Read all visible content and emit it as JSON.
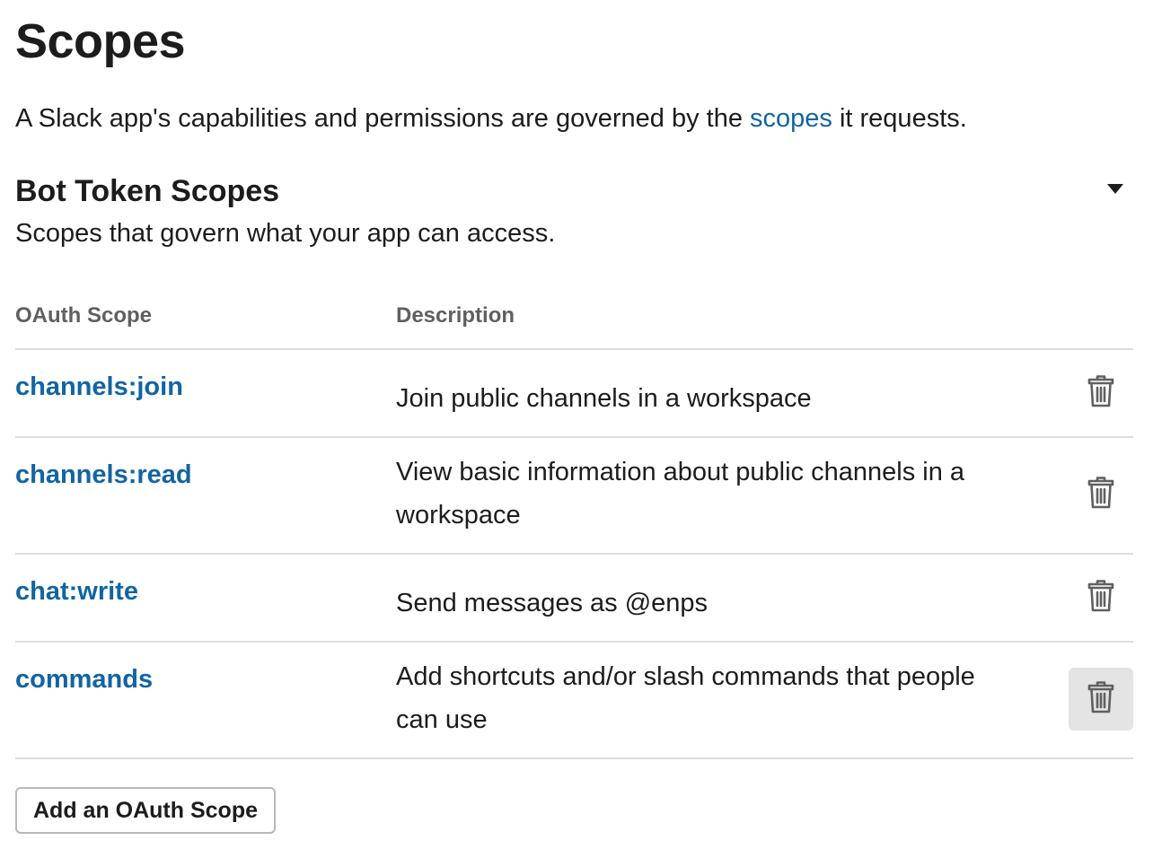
{
  "page": {
    "title": "Scopes",
    "intro_before": "A Slack app's capabilities and permissions are governed by the ",
    "intro_link": "scopes",
    "intro_after": " it requests."
  },
  "section": {
    "title": "Bot Token Scopes",
    "subtitle": "Scopes that govern what your app can access.",
    "collapse_icon": "caret-down-icon"
  },
  "table": {
    "headers": {
      "scope": "OAuth Scope",
      "description": "Description"
    },
    "rows": [
      {
        "scope": "channels:join",
        "description": "Join public channels in a workspace",
        "delete_icon": "trash-icon"
      },
      {
        "scope": "channels:read",
        "description": "View basic information about public channels in a workspace",
        "delete_icon": "trash-icon"
      },
      {
        "scope": "chat:write",
        "description": "Send messages as @enps",
        "delete_icon": "trash-icon"
      },
      {
        "scope": "commands",
        "description": "Add shortcuts and/or slash commands that people can use",
        "delete_icon": "trash-icon",
        "hovered": true
      }
    ]
  },
  "actions": {
    "add_scope_label": "Add an OAuth Scope"
  },
  "colors": {
    "link": "#1264a3",
    "text": "#1d1c1d",
    "muted": "#616061",
    "divider": "#dddddd",
    "hover_bg": "#e4e4e4"
  }
}
